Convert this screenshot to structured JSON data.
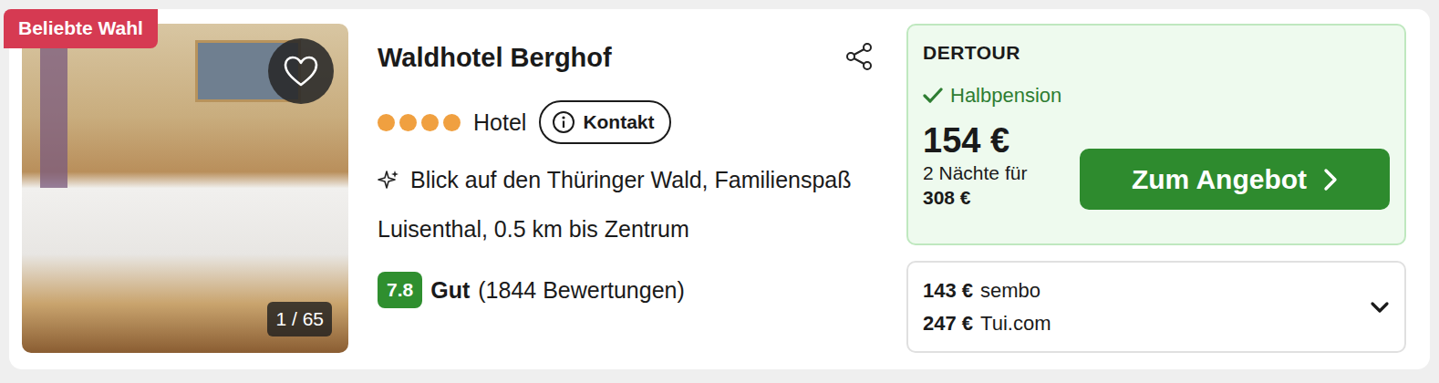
{
  "badge": "Beliebte Wahl",
  "favorite": false,
  "image_counter": "1 / 65",
  "hotel": {
    "name": "Waldhotel Berghof",
    "stars": 4,
    "type": "Hotel",
    "contact": "Kontakt",
    "highlights": "Blick auf den Thüringer Wald, Familienspaß",
    "location": "Luisenthal, 0.5 km bis Zentrum",
    "rating": {
      "score": "7.8",
      "label": "Gut",
      "count": "(1844 Bewertungen)"
    }
  },
  "offer": {
    "provider": "DERTOUR",
    "board": "Halbpension",
    "board_included": true,
    "price": "154 €",
    "nights": "2 Nächte für",
    "total": "308 €",
    "button": "Zum Angebot"
  },
  "other_offers": {
    "expanded": false,
    "items": [
      {
        "price": "143 €",
        "provider": "sembo"
      },
      {
        "price": "247 €",
        "provider": "Tui.com"
      }
    ]
  }
}
